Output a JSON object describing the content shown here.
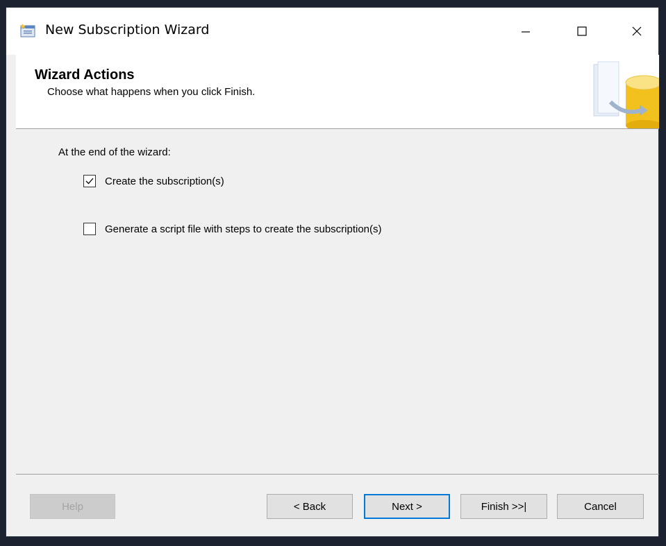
{
  "window": {
    "title": "New Subscription Wizard",
    "icon": "wizard-app-icon"
  },
  "titlebar_controls": {
    "minimize_icon": "minimize-icon",
    "maximize_icon": "maximize-icon",
    "close_icon": "close-icon"
  },
  "header": {
    "title": "Wizard Actions",
    "subtitle": "Choose what happens when you click Finish."
  },
  "body": {
    "section_label": "At the end of the wizard:",
    "options": [
      {
        "label": "Create the subscription(s)",
        "checked": true
      },
      {
        "label": "Generate a script file with steps to create the subscription(s)",
        "checked": false
      }
    ]
  },
  "footer": {
    "help_label": "Help",
    "back_label": "< Back",
    "next_label": "Next >",
    "finish_label": "Finish >>|",
    "cancel_label": "Cancel"
  },
  "colors": {
    "accent": "#0078d7",
    "dialog_bg": "#f0f0f0",
    "header_bg": "#ffffff"
  }
}
